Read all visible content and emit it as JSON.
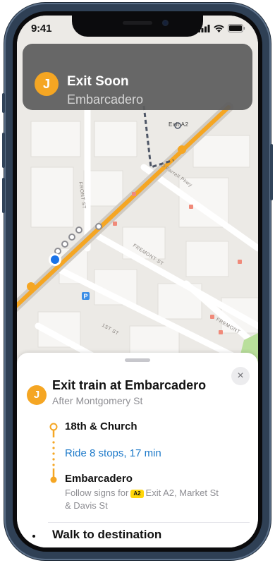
{
  "status": {
    "time": "9:41"
  },
  "notification": {
    "badge": "J",
    "title": "Exit Soon",
    "subtitle": "Embarcadero"
  },
  "map": {
    "labels": {
      "exit": "Exit A2",
      "front": "FRONT ST",
      "ofarrell": "O'Farrell Pkwy",
      "fremont": "FREMONT ST",
      "fremont2": "FREMONT",
      "first": "1ST ST"
    },
    "parking": "P"
  },
  "card": {
    "close_symbol": "×",
    "badge": "J",
    "title": "Exit train at Embarcadero",
    "subtitle": "After Montgomery St",
    "stop_start": "18th & Church",
    "ride": "Ride 8 stops, 17 min",
    "stop_end": "Embarcadero",
    "follow_pre": "Follow signs for",
    "exit_chip": "A2",
    "follow_post": "Exit A2, Market St & Davis St",
    "walk_label": "Walk to destination"
  },
  "colors": {
    "transit_line": "#f5a623",
    "ride_link": "#1c79c9",
    "banner_bg": "#5c5c5c"
  }
}
